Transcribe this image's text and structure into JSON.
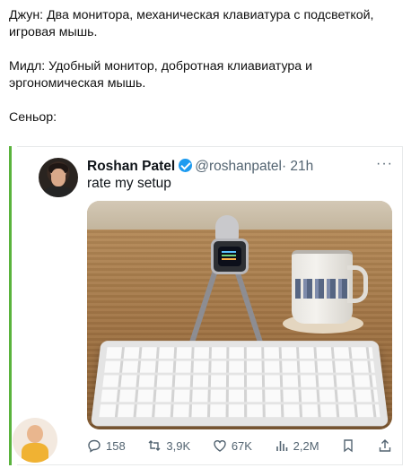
{
  "message": {
    "lines": [
      "Джун: Два монитора, механическая клавиатура с подсветкой, игровая мышь.",
      "Мидл: Удобный монитор, добротная клиавиатура и эргономическая мышь.",
      "Сеньор:"
    ]
  },
  "tweet": {
    "name": "Roshan Patel",
    "handle": "@roshanpatel",
    "time": "· 21h",
    "text": "rate my setup",
    "actions": {
      "replies": "158",
      "retweets": "3,9K",
      "likes": "67K",
      "views": "2,2M"
    }
  },
  "icons": {
    "verified": "verified-badge-icon",
    "more": "more-icon",
    "reply": "reply-icon",
    "retweet": "retweet-icon",
    "like": "heart-icon",
    "views": "views-icon",
    "bookmark": "bookmark-icon",
    "share": "share-icon"
  },
  "colors": {
    "quote_bar": "#5ab33d",
    "twitter_blue": "#1d9bf0",
    "muted": "#536471"
  }
}
